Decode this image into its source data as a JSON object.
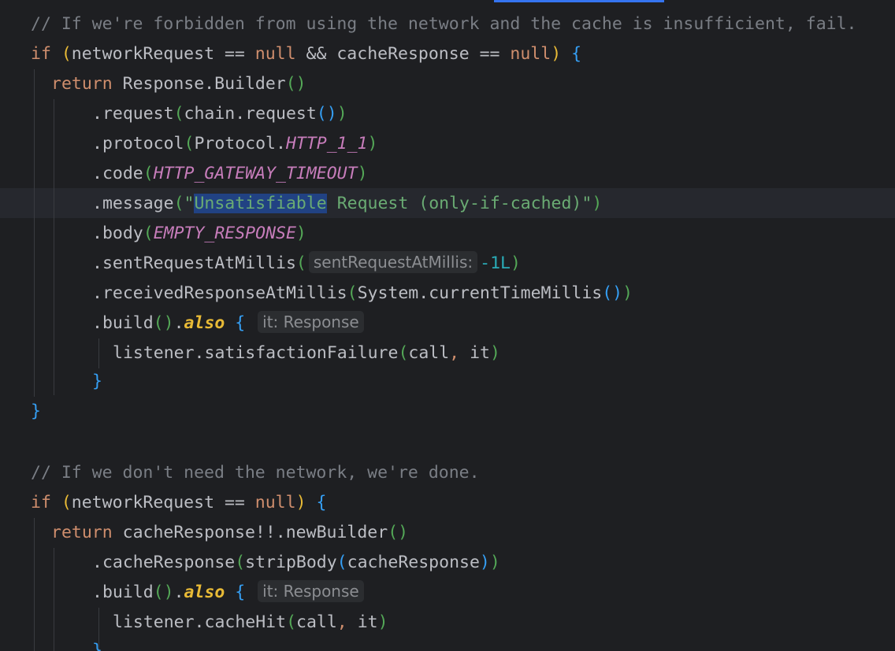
{
  "editor": {
    "comment1": "// If we're forbidden from using the network and the cache is insufficient, fail.",
    "comment2": "// If we don't need the network, we're done.",
    "kw_if": "if",
    "kw_return": "return",
    "kw_null": "null",
    "kw_also": "also",
    "var_networkRequest": "networkRequest",
    "var_cacheResponse": "cacheResponse",
    "op_eq": " == ",
    "op_and": " && ",
    "op_bang": "!!",
    "cls_ResponseBuilder": "Response.Builder",
    "m_request": ".request",
    "chain_request": "chain.request",
    "m_protocol": ".protocol",
    "protocol_cls": "Protocol.",
    "const_http11": "HTTP_1_1",
    "m_code": ".code",
    "const_gateway": "HTTP_GATEWAY_TIMEOUT",
    "m_message": ".message",
    "str_quote": "\"",
    "str_selected": "Unsatisfiable",
    "str_rest": " Request (only-if-cached)",
    "m_body": ".body",
    "const_empty": "EMPTY_RESPONSE",
    "m_sent": ".sentRequestAtMillis",
    "hint_sent": "sentRequestAtMillis:",
    "num_neg1": "-1L",
    "m_received": ".receivedResponseAtMillis",
    "system_cls": "System.currentTimeMillis",
    "m_build": ".build",
    "hint_it": "it: Response",
    "listener_satisfaction": "listener.satisfactionFailure",
    "arg_call": "call",
    "arg_it": "it",
    "comma": ", ",
    "new_builder": ".newBuilder",
    "m_cacheResponse": ".cacheResponse",
    "fn_stripBody": "stripBody",
    "listener_cacheHit": "listener.cacheHit"
  }
}
